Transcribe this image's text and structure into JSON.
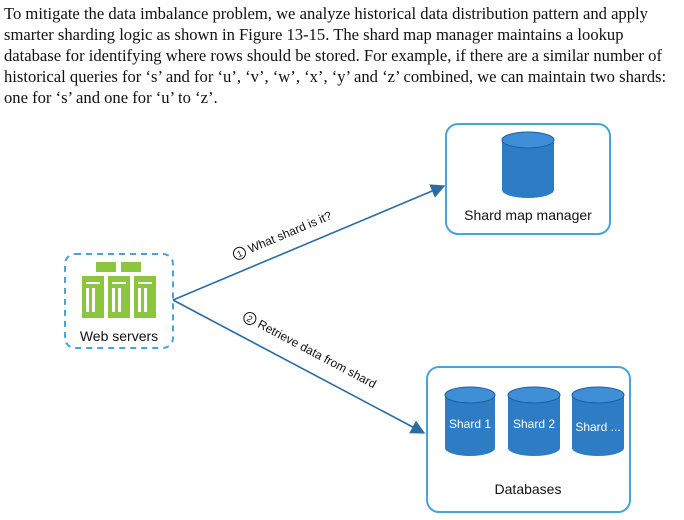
{
  "paragraph": "To mitigate the data imbalance problem, we analyze historical data distribution pattern and apply smarter sharding logic as shown in Figure 13-15. The shard map manager maintains a lookup database for identifying where rows should be stored. For example, if there are a similar number of historical queries for ‘s’ and for ‘u’, ‘v’, ‘w’, ‘x’, ‘y’ and ‘z’ combined, we can maintain two shards: one for ‘s’ and one for ‘u’ to ‘z’.",
  "diagram": {
    "web_servers_label": "Web servers",
    "shard_map_manager_label": "Shard map manager",
    "databases_label": "Databases",
    "step1": {
      "number": "1",
      "label": "What shard is it?"
    },
    "step2": {
      "number": "2",
      "label": "Retrieve data from shard"
    },
    "shards": [
      "Shard 1",
      "Shard 2",
      "Shard ..."
    ]
  },
  "colors": {
    "box_border": "#4aa3d8",
    "server_green": "#8cc63f",
    "server_green_dark": "#5f9a1f",
    "db_blue": "#2e7cc4",
    "db_blue_dark": "#1f5f9c",
    "arrow": "#2b6ca3",
    "dashed": "#4aa3d8"
  },
  "icons": [
    "server-rack-icon",
    "database-icon"
  ]
}
